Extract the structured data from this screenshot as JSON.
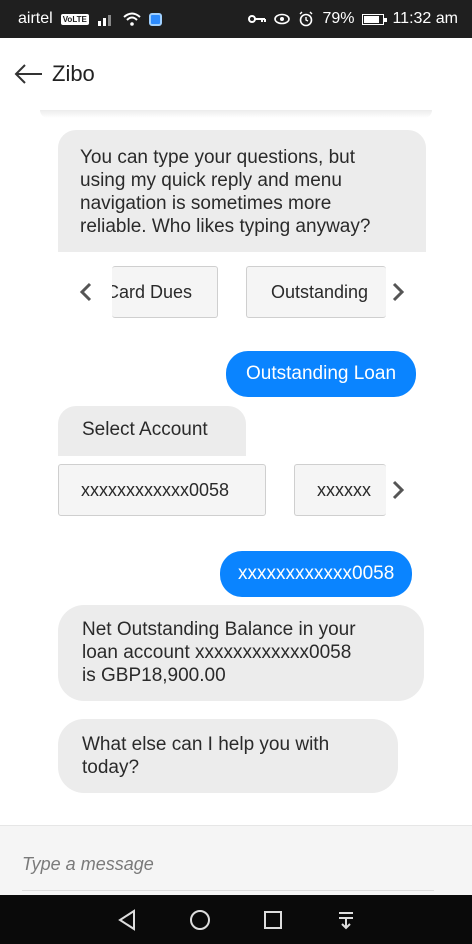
{
  "status_bar": {
    "carrier": "airtel",
    "volte_label": "VoLTE",
    "battery": "79%",
    "time": "11:32 am"
  },
  "header": {
    "title": "Zibo"
  },
  "chat": {
    "intro_message": {
      "lines": [
        "You can type your questions, but",
        "using my quick reply and menu",
        "navigation is sometimes more",
        "reliable. Who likes typing anyway?"
      ]
    },
    "quick_replies": {
      "items": [
        "Card Dues",
        "Outstanding"
      ]
    },
    "user_message_1": "Outstanding Loan",
    "select_account_prompt": "Select Account",
    "account_options": {
      "items": [
        "xxxxxxxxxxxx0058",
        "xxxxxx"
      ]
    },
    "user_message_2": "xxxxxxxxxxxx0058",
    "balance_message": {
      "lines": [
        "Net Outstanding Balance in your",
        "loan account xxxxxxxxxxxx0058",
        "is GBP18,900.00"
      ]
    },
    "followup_message": {
      "lines": [
        "What else can I help you with",
        "today?"
      ]
    }
  },
  "input": {
    "placeholder": "Type a message"
  },
  "colors": {
    "accent": "#0a84ff",
    "bot_bubble": "#ececec",
    "status_bar": "#1f1f1f"
  }
}
